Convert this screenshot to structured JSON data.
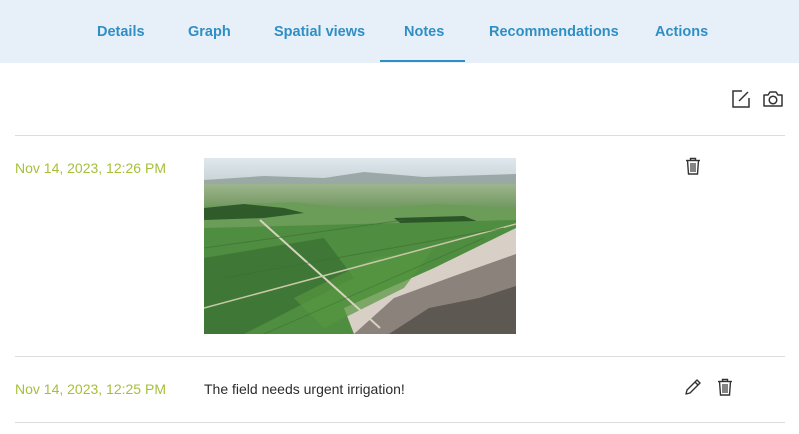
{
  "tabs": [
    {
      "label": "Details",
      "active": false
    },
    {
      "label": "Graph",
      "active": false
    },
    {
      "label": "Spatial views",
      "active": false
    },
    {
      "label": "Notes",
      "active": true
    },
    {
      "label": "Recommendations",
      "active": false
    },
    {
      "label": "Actions",
      "active": false
    }
  ],
  "toolbar": {
    "icons": [
      "edit-note-icon",
      "camera-icon"
    ]
  },
  "notes": [
    {
      "timestamp": "Nov 14, 2023, 12:26 PM",
      "type": "image",
      "image": "aerial-farm-fields-photo",
      "actions": [
        "trash-icon"
      ]
    },
    {
      "timestamp": "Nov 14, 2023, 12:25 PM",
      "type": "text",
      "text": "The field needs urgent irrigation!",
      "actions": [
        "pencil-icon",
        "trash-icon"
      ]
    }
  ],
  "colors": {
    "accent": "#2f8fc5",
    "tab_bar_bg": "#e7f0f9",
    "timestamp": "#a6bf3a",
    "divider": "#dcdcdc",
    "text": "#2b2b2b"
  }
}
